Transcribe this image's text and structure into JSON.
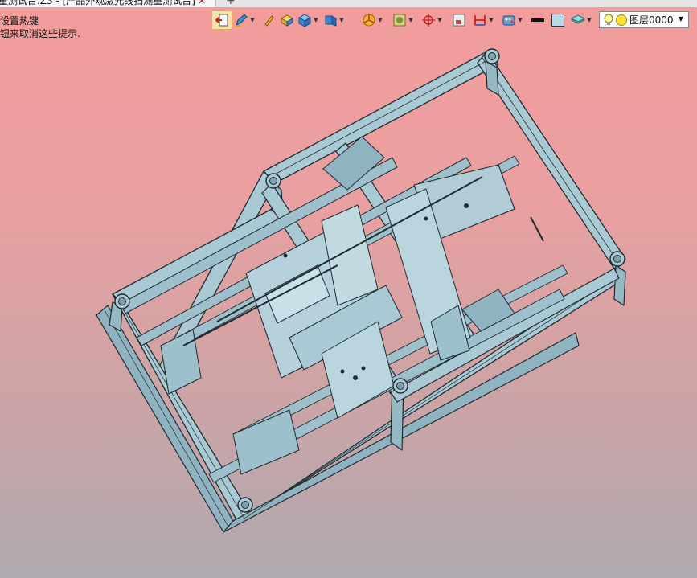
{
  "window": {
    "tab_title": "量测试台.Z3 - [产品外观激光线扫测量测试台]",
    "tab_close": "✕",
    "tab_add": "+"
  },
  "hints": {
    "line1": " 设置热键",
    "line2": "钮来取消这些提示."
  },
  "toolbar": {
    "items": [
      {
        "name": "exit-sketch-icon"
      },
      {
        "name": "pen-tool-icon"
      },
      {
        "name": "pencil-icon"
      },
      {
        "name": "box-shaded-icon"
      },
      {
        "name": "cube-view-icon"
      },
      {
        "name": "cube-iso-icon"
      },
      {
        "name": "filter-pie-icon"
      },
      {
        "name": "render-mode-icon"
      },
      {
        "name": "crosshair-icon"
      },
      {
        "name": "frame-icon"
      },
      {
        "name": "dimension-icon"
      },
      {
        "name": "style-palette-icon"
      },
      {
        "name": "line-color-icon"
      },
      {
        "name": "fill-color-icon"
      },
      {
        "name": "layer-stack-icon"
      }
    ],
    "layer_label": "图层0000",
    "colors": {
      "line_color": "#111111",
      "fill_color": "#b8d9e8",
      "accent": "#ffe23a"
    }
  },
  "viewport": {
    "model_description_color": "#a9c9d4"
  }
}
